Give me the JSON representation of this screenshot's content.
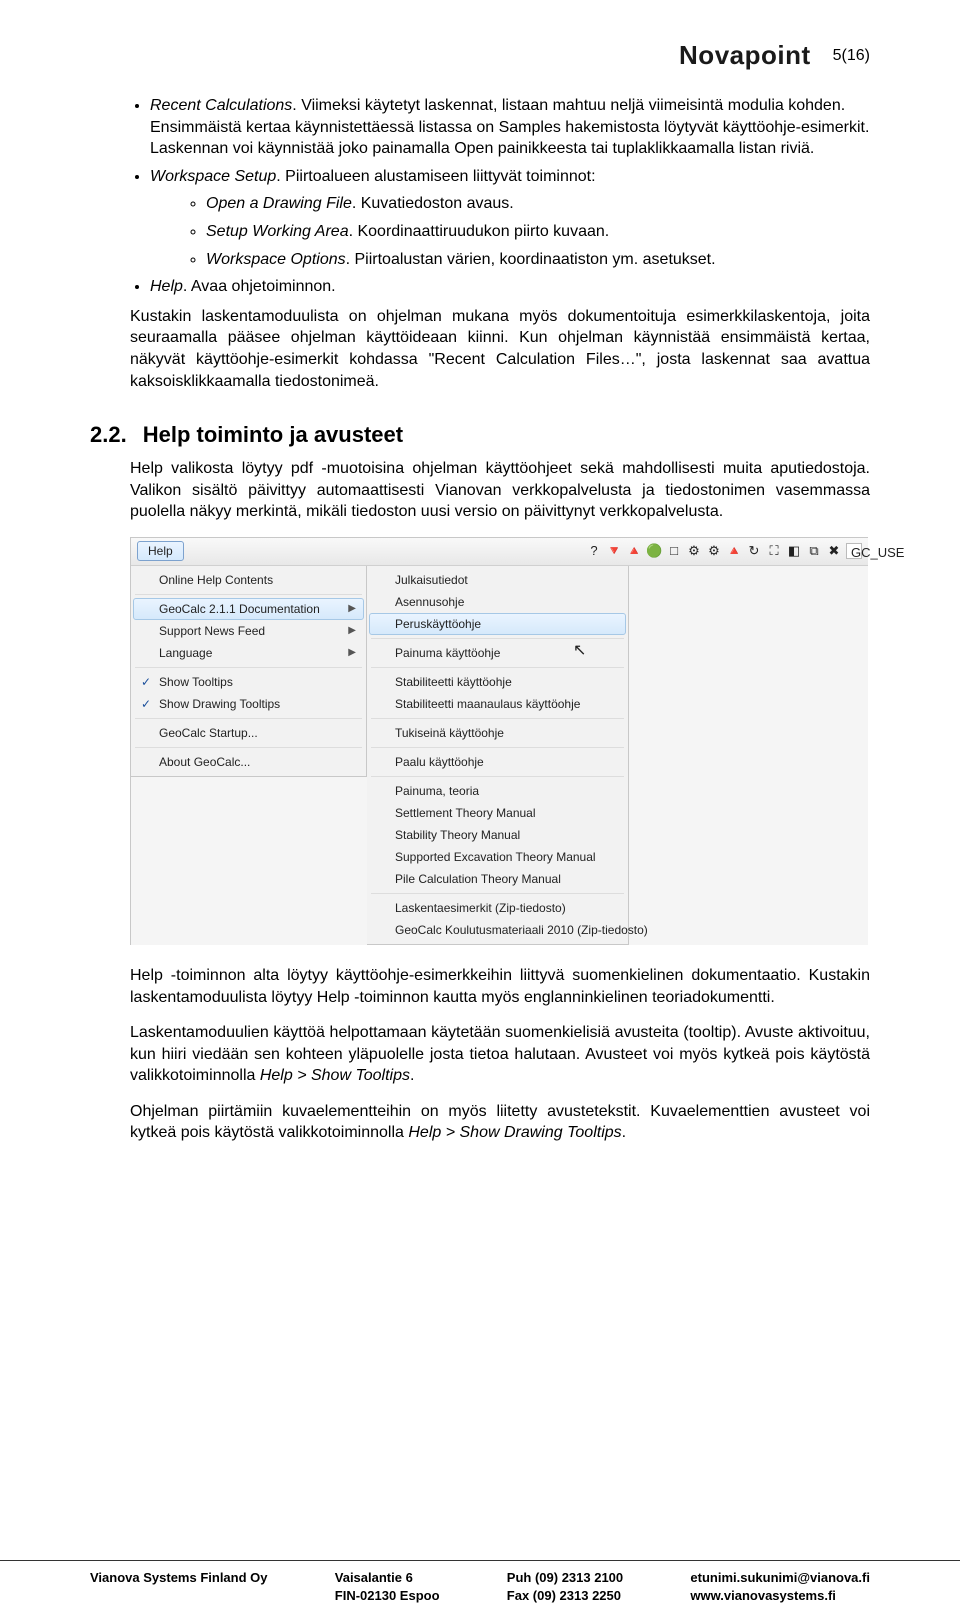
{
  "header": {
    "brand": "Novapoint",
    "page_indicator": "5(16)"
  },
  "bullets1": [
    {
      "lead_italic": "Recent Calculations",
      "rest": ". Viimeksi käytetyt laskennat, listaan mahtuu neljä viimeisintä modulia kohden. Ensimmäistä kertaa käynnistettäessä listassa on Samples hakemistosta löytyvät käyttöohje-esimerkit. Laskennan voi käynnistää joko painamalla Open painikkeesta tai tuplaklikkaamalla listan riviä."
    },
    {
      "lead_italic": "Workspace Setup",
      "rest": ". Piirtoalueen alustamiseen liittyvät toiminnot:",
      "sub": [
        {
          "lead_italic": "Open a Drawing File",
          "rest": ". Kuvatiedoston avaus."
        },
        {
          "lead_italic": "Setup Working Area",
          "rest": ". Koordinaattiruudukon piirto kuvaan."
        },
        {
          "lead_italic": "Workspace Options",
          "rest": ". Piirtoalustan värien, koordinaatiston ym. asetukset."
        }
      ]
    },
    {
      "lead_italic": "Help",
      "rest": ". Avaa ohjetoiminnon."
    }
  ],
  "para1": "Kustakin laskentamoduulista on ohjelman mukana myös dokumentoituja esimerkkilaskentoja, joita seuraamalla pääsee ohjelman käyttöideaan kiinni. Kun ohjelman käynnistää ensimmäistä kertaa, näkyvät käyttöohje-esimerkit kohdassa \"Recent Calculation Files…\", josta laskennat saa avattua kaksoisklikkaamalla tiedostonimeä.",
  "section": {
    "number": "2.2.",
    "title": "Help toiminto ja avusteet"
  },
  "para2": "Help valikosta löytyy pdf -muotoisina ohjelman käyttöohjeet sekä mahdollisesti muita aputiedostoja. Valikon sisältö päivittyy automaattisesti Vianovan verkkopalvelusta ja tiedostonimen vasemmassa puolella näkyy merkintä, mikäli tiedoston uusi versio on päivittynyt verkkopalvelusta.",
  "menu": {
    "button": "Help",
    "toolbar_glyphs": [
      "?",
      "🔻",
      "🔺",
      "🟢",
      "□",
      "⚙",
      "⚙",
      "🔺",
      "↻",
      "⛶",
      "◧",
      "⧉",
      "✖"
    ],
    "gc_label": "GC_USE",
    "main": [
      {
        "label": "Online Help Contents",
        "sep_after": true
      },
      {
        "label": "GeoCalc 2.1.1 Documentation",
        "arrow": true,
        "active": true
      },
      {
        "label": "Support News Feed",
        "arrow": true
      },
      {
        "label": "Language",
        "arrow": true,
        "sep_after": true
      },
      {
        "label": "Show Tooltips",
        "checked": true
      },
      {
        "label": "Show Drawing Tooltips",
        "checked": true,
        "sep_after": true
      },
      {
        "label": "GeoCalc Startup...",
        "sep_after": true
      },
      {
        "label": "About GeoCalc..."
      }
    ],
    "sub": [
      {
        "label": "Julkaisutiedot"
      },
      {
        "label": "Asennusohje"
      },
      {
        "label": "Peruskäyttöohje",
        "highlight": true,
        "sep_after": true
      },
      {
        "label": "Painuma käyttöohje",
        "sep_after": true
      },
      {
        "label": "Stabiliteetti käyttöohje"
      },
      {
        "label": "Stabiliteetti maanaulaus käyttöohje",
        "sep_after": true
      },
      {
        "label": "Tukiseinä käyttöohje",
        "sep_after": true
      },
      {
        "label": "Paalu käyttöohje",
        "sep_after": true
      },
      {
        "label": "Painuma, teoria"
      },
      {
        "label": "Settlement Theory Manual"
      },
      {
        "label": "Stability Theory Manual"
      },
      {
        "label": "Supported Excavation Theory Manual"
      },
      {
        "label": "Pile Calculation Theory Manual",
        "sep_after": true
      },
      {
        "label": "Laskentaesimerkit (Zip-tiedosto)"
      },
      {
        "label": "GeoCalc Koulutusmateriaali 2010 (Zip-tiedosto)"
      }
    ]
  },
  "para3": "Help -toiminnon alta löytyy käyttöohje-esimerkkeihin liittyvä suomenkielinen dokumentaatio. Kustakin laskentamoduulista löytyy Help -toiminnon kautta myös englanninkielinen teoriadokumentti.",
  "para4_a": "Laskentamoduulien käyttöä helpottamaan käytetään suomenkielisiä avusteita (tooltip). Avuste aktivoituu, kun hiiri viedään sen kohteen yläpuolelle josta tietoa halutaan. Avusteet voi myös kytkeä pois käytöstä valikkotoiminnolla ",
  "para4_italic": "Help > Show Tooltips",
  "para5_a": "Ohjelman piirtämiin kuvaelementteihin on myös liitetty avustetekstit. Kuvaelementtien avusteet voi kytkeä pois käytöstä valikkotoiminnolla ",
  "para5_italic": "Help > Show Drawing Tooltips",
  "footer": {
    "c1a": "Vianova Systems Finland Oy",
    "c2a": "Vaisalantie 6",
    "c2b": "FIN-02130 Espoo",
    "c3a": "Puh  (09) 2313 2100",
    "c3b": "Fax  (09) 2313 2250",
    "c4a": "etunimi.sukunimi@vianova.fi",
    "c4b": "www.vianovasystems.fi"
  }
}
